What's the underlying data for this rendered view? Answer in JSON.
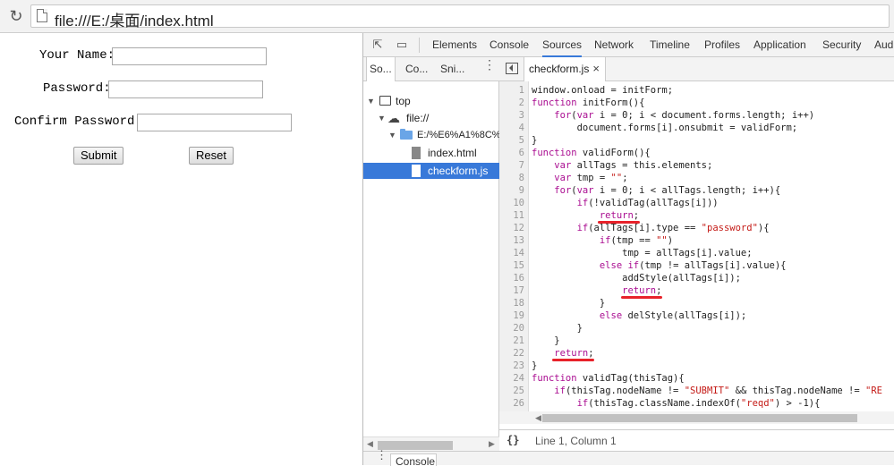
{
  "browser": {
    "url": "file:///E:/桌面/index.html"
  },
  "form": {
    "name_label": "Your Name:",
    "password_label": "Password:",
    "confirm_label": "Confirm Password:",
    "submit_label": "Submit",
    "reset_label": "Reset"
  },
  "devtools": {
    "tabs": [
      "Elements",
      "Console",
      "Sources",
      "Network",
      "Timeline",
      "Profiles",
      "Application",
      "Security",
      "Audi"
    ],
    "active_tab": "Sources",
    "navigator_tabs": [
      "So...",
      "Co...",
      "Sni..."
    ],
    "tree": [
      "top",
      "file://",
      "E:/%E6%A1%8C%",
      "index.html",
      "checkform.js"
    ],
    "selected_file": "checkform.js",
    "open_file_tab": "checkform.js",
    "status": "Line 1, Column 1",
    "status_braces": "{}",
    "drawer_tab": "Console"
  },
  "code_lines": [
    "window.onload = initForm;",
    "function initForm(){",
    "    for(var i = 0; i < document.forms.length; i++)",
    "        document.forms[i].onsubmit = validForm;",
    "}",
    "function validForm(){",
    "    var allTags = this.elements;",
    "    var tmp = \"\";",
    "    for(var i = 0; i < allTags.length; i++){",
    "        if(!validTag(allTags[i]))",
    "            return;",
    "        if(allTags[i].type == \"password\"){",
    "            if(tmp == \"\")",
    "                tmp = allTags[i].value;",
    "            else if(tmp != allTags[i].value){",
    "                addStyle(allTags[i]);",
    "                return;",
    "            }",
    "            else delStyle(allTags[i]);",
    "        }",
    "    }",
    "    return;",
    "}",
    "function validTag(thisTag){",
    "    if(thisTag.nodeName != \"SUBMIT\" && thisTag.nodeName != \"RE",
    "        if(thisTag.className.indexOf(\"reqd\") > -1){",
    "            "
  ],
  "annotation_color": "#e8222a",
  "accent_color": "#3879d9"
}
